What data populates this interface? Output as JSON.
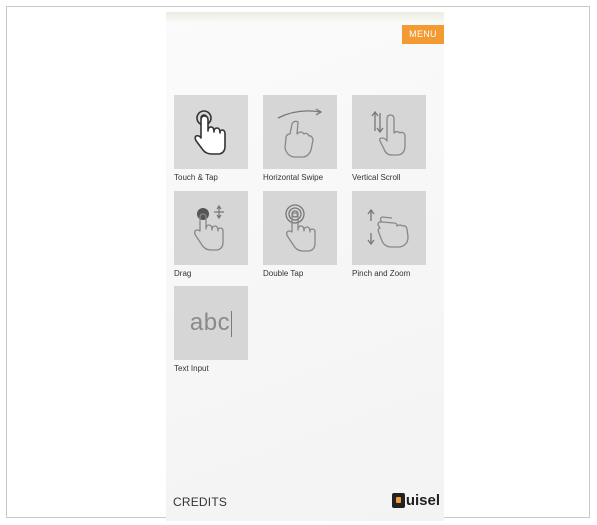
{
  "menu": {
    "label": "MENU",
    "color": "#f39a33"
  },
  "tiles": [
    {
      "label": "Touch & Tap",
      "icon": "touch-tap-icon"
    },
    {
      "label": "Horizontal Swipe",
      "icon": "horizontal-swipe-icon"
    },
    {
      "label": "Vertical Scroll",
      "icon": "vertical-scroll-icon"
    },
    {
      "label": "Drag",
      "icon": "drag-icon"
    },
    {
      "label": "Double Tap",
      "icon": "double-tap-icon"
    },
    {
      "label": "Pinch and Zoom",
      "icon": "pinch-zoom-icon"
    },
    {
      "label": "Text Input",
      "icon": "text-input-icon",
      "glyph": "abc"
    }
  ],
  "footer": {
    "credits": "CREDITS",
    "logo_text": "uisel"
  }
}
